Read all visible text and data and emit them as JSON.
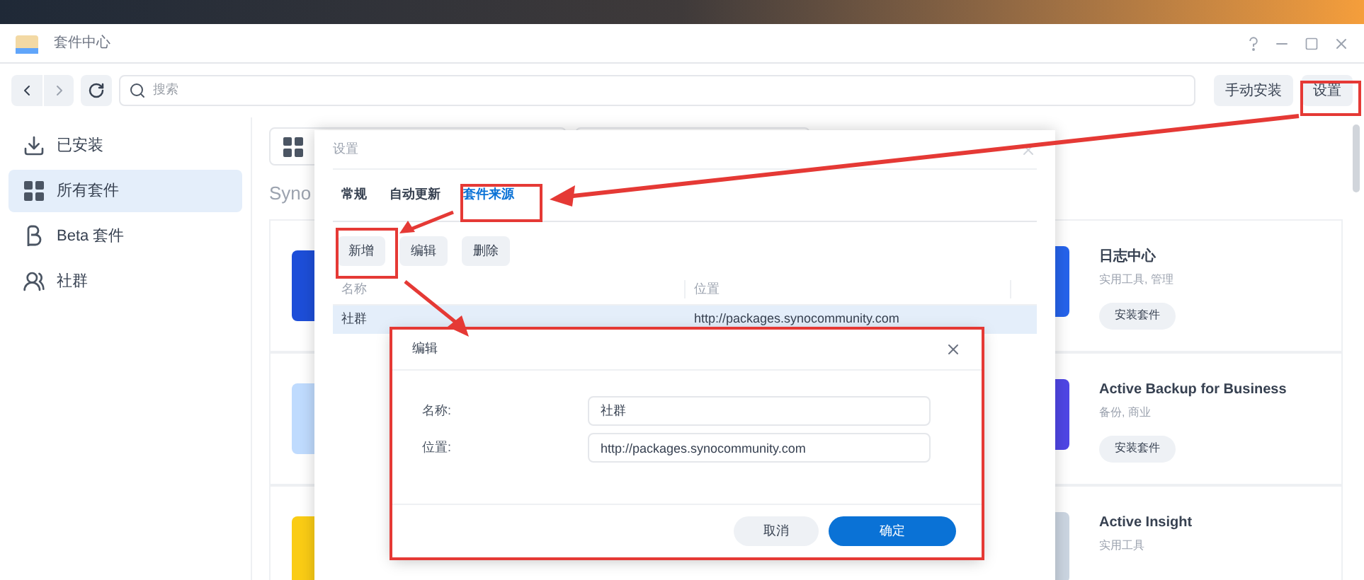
{
  "window": {
    "title": "套件中心"
  },
  "toolbar": {
    "search": {
      "placeholder": "搜索"
    },
    "buttons": [
      "手动安装",
      "设置"
    ]
  },
  "sidebar": {
    "items": [
      {
        "label": "已安装",
        "kind": "download",
        "selected": false
      },
      {
        "label": "所有套件",
        "kind": "grid",
        "selected": true
      },
      {
        "label": "Beta 套件",
        "kind": "beta",
        "selected": false
      },
      {
        "label": "社群",
        "kind": "community",
        "selected": false
      }
    ]
  },
  "content": {
    "section_title": "Syno",
    "packages": [
      {
        "name": "日志中心",
        "category": "实用工具, 管理",
        "action": "安装套件",
        "color": "#2563eb"
      },
      {
        "name": "Active Backup for Business",
        "category": "备份, 商业",
        "action": "安装套件",
        "color": "#4f46e5"
      },
      {
        "name": "Active Insight",
        "category": "实用工具",
        "color": "#cbd5e1"
      }
    ]
  },
  "settings_dialog": {
    "title": "设置",
    "tabs": [
      {
        "label": "常规",
        "selected": false
      },
      {
        "label": "自动更新",
        "selected": false
      },
      {
        "label": "套件来源",
        "selected": true
      }
    ],
    "buttons": [
      "新增",
      "编辑",
      "删除"
    ],
    "table": {
      "columns": [
        "名称",
        "位置"
      ],
      "rows": [
        {
          "cells": [
            "社群",
            "http://packages.synocommunity.com"
          ],
          "selected": true
        }
      ]
    }
  },
  "edit_dialog": {
    "title": "编辑",
    "fields": [
      {
        "label": "名称:",
        "value": "社群"
      },
      {
        "label": "位置:",
        "value": "http://packages.synocommunity.com"
      }
    ],
    "buttons": [
      {
        "label": "取消",
        "kind": "secondary"
      },
      {
        "label": "确定",
        "kind": "primary"
      }
    ]
  }
}
